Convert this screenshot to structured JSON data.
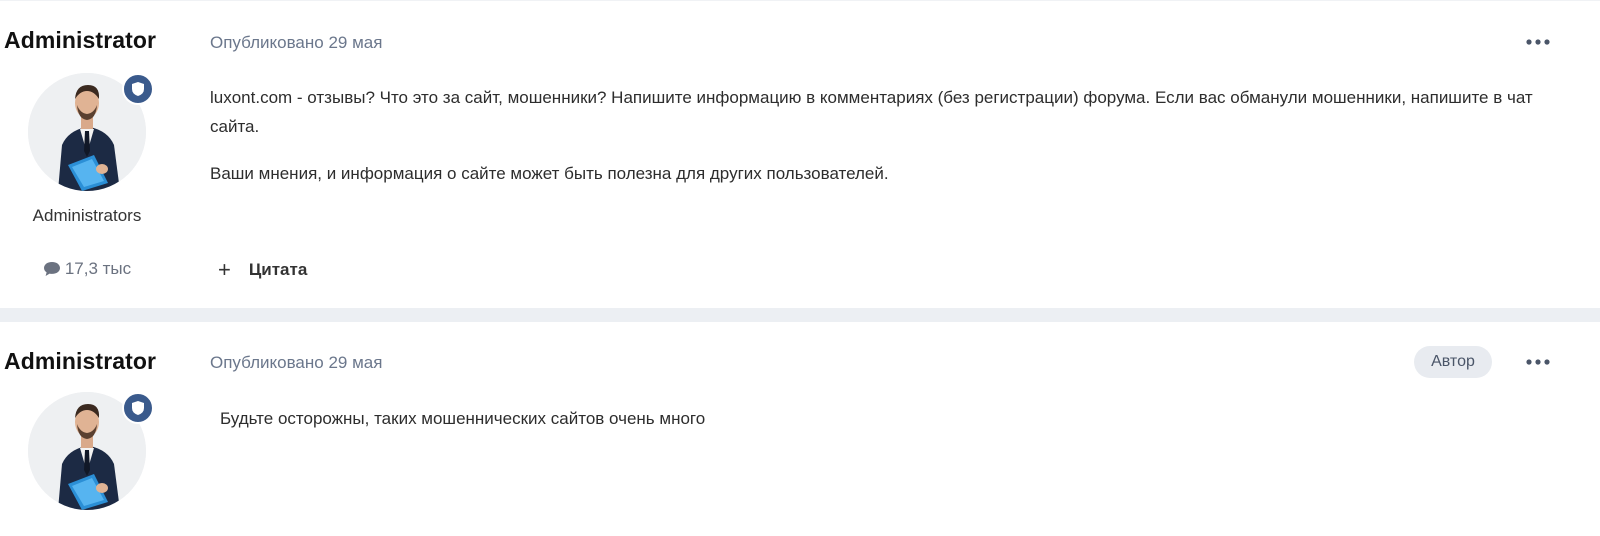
{
  "posts": [
    {
      "author": "Administrator",
      "group": "Administrators",
      "post_count": "17,3 тыс",
      "published": "Опубликовано 29 мая",
      "paragraphs": [
        "luxont.com - отзывы? Что это за сайт, мошенники? Напишите информацию в комментариях (без регистрации) форума. Если вас обманули мошенники, напишите в чат сайта.",
        "Ваши мнения, и информация о сайте может быть полезна для других пользователей."
      ],
      "quote_label": "Цитата"
    },
    {
      "author": "Administrator",
      "published": "Опубликовано 29 мая",
      "author_badge": "Автор",
      "paragraphs": [
        "Будьте осторожны, таких мошеннических сайтов очень много"
      ]
    }
  ],
  "icons": {
    "more": "ellipsis-icon",
    "badge": "shield-icon",
    "comment": "speech-bubble-icon",
    "quote_plus": "plus-icon"
  },
  "colors": {
    "badge_blue": "#3a5a8c",
    "meta_text": "#6b778c",
    "separator": "#eceff3"
  }
}
